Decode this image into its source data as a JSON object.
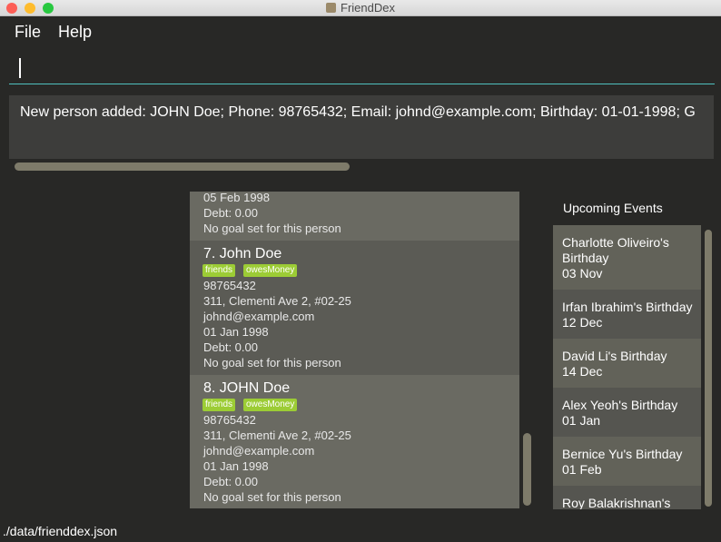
{
  "window": {
    "title": "FriendDex"
  },
  "menu": {
    "file": "File",
    "help": "Help"
  },
  "command": {
    "value": "",
    "placeholder": ""
  },
  "result": {
    "text": "New person added: JOHN Doe; Phone: 98765432; Email: johnd@example.com; Birthday: 01-01-1998; G"
  },
  "persons": {
    "partial": {
      "birthday": "05 Feb 1998",
      "debt": "Debt: 0.00",
      "goal": "No goal set for this person"
    },
    "cards": [
      {
        "index_name": "7.  John Doe",
        "tags": [
          "friends",
          "owesMoney"
        ],
        "phone": "98765432",
        "address": "311, Clementi Ave 2, #02-25",
        "email": "johnd@example.com",
        "birthday": "01 Jan 1998",
        "debt": "Debt: 0.00",
        "goal": "No goal set for this person"
      },
      {
        "index_name": "8.  JOHN Doe",
        "tags": [
          "friends",
          "owesMoney"
        ],
        "phone": "98765432",
        "address": "311, Clementi Ave 2, #02-25",
        "email": "johnd@example.com",
        "birthday": "01 Jan 1998",
        "debt": "Debt: 0.00",
        "goal": "No goal set for this person"
      }
    ]
  },
  "events": {
    "title": "Upcoming Events",
    "items": [
      {
        "line1": "Charlotte Oliveiro's",
        "line2": "Birthday",
        "date": "03 Nov"
      },
      {
        "line1": "Irfan Ibrahim's Birthday",
        "date": "12 Dec"
      },
      {
        "line1": "David Li's Birthday",
        "date": "14 Dec"
      },
      {
        "line1": "Alex Yeoh's Birthday",
        "date": "01 Jan"
      },
      {
        "line1": "Bernice Yu's Birthday",
        "date": "01 Feb"
      },
      {
        "line1": "Roy Balakrishnan's"
      }
    ]
  },
  "status": {
    "path": "./data/frienddex.json"
  },
  "colors": {
    "accent": "#4fc1bf",
    "tag": "#9ccc35",
    "background": "#282826"
  }
}
